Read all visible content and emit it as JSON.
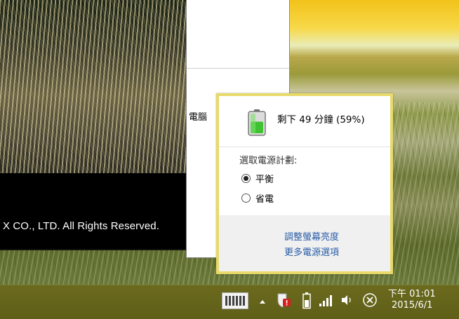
{
  "game_window": {
    "copyright": "X CO., LTD. All Rights Reserved."
  },
  "background_window": {
    "partial_label": "電腦"
  },
  "battery_flyout": {
    "status": "剩下 49 分鐘 (59%)",
    "battery_percent": 59,
    "plan_heading": "選取電源計劃:",
    "plans": [
      {
        "label": "平衡",
        "selected": true
      },
      {
        "label": "省電",
        "selected": false
      }
    ],
    "links": {
      "adjust_brightness": "調整螢幕亮度",
      "more_options": "更多電源選項"
    },
    "accent_color": "#e8d96a",
    "link_color": "#2a5ea8",
    "battery_color": "#3fc232"
  },
  "taskbar": {
    "icons": [
      "keyboard-icon",
      "chevron-up-icon",
      "security-icon",
      "battery-icon",
      "signal-icon",
      "volume-icon",
      "close-circle-icon"
    ],
    "clock_time": "下午 01:01",
    "clock_date": "2015/6/1",
    "color": "#5f5e18"
  }
}
